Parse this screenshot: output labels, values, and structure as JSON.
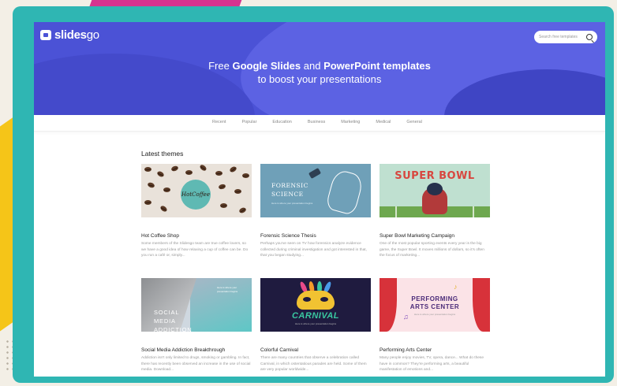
{
  "brand": {
    "logo_bold": "slides",
    "logo_light": "go"
  },
  "search": {
    "placeholder": "Search free templates"
  },
  "hero": {
    "line1_pre": "Free ",
    "line1_bold1": "Google Slides",
    "line1_mid": " and ",
    "line1_bold2": "PowerPoint templates",
    "line2": "to boost your presentations"
  },
  "categories": [
    "Recent",
    "Popular",
    "Education",
    "Business",
    "Marketing",
    "Medical",
    "General"
  ],
  "section_title": "Latest themes",
  "themes": [
    {
      "title": "Hot Coffee Shop",
      "description": "Some members of the Slidesgo team are true coffee lovers, so we have a good idea of how relaxing a cup of coffee can be. Do you run a café or, simply...",
      "thumb_text": "HotCoffee"
    },
    {
      "title": "Forensic Science Thesis",
      "description": "Perhaps you've seen on TV how forensics analyze evidence collected during criminal investigation and got interested in that, that you began studying...",
      "thumb_text": "FORENSIC SCIENCE",
      "thumb_sub": "Here is where your presentation begins"
    },
    {
      "title": "Super Bowl Marketing Campaign",
      "description": "One of the most popular sporting events every year is the big game, the Super Bowl. It moves millions of dollars, so it's often the focus of marketing...",
      "thumb_text": "SUPER BOWL"
    },
    {
      "title": "Social Media Addiction Breakthrough",
      "description": "Addiction isn't only limited to drugs, smoking or gambling. In fact, there has recently been observed an increase in the use of social media. Download...",
      "thumb_text": "SOCIAL MEDIA ADDICTION",
      "thumb_sub": "Here is where your presentation begins"
    },
    {
      "title": "Colorful Carnival",
      "description": "There are many countries that observe a celebration called Carnival, in which ostentatious parades are held. Some of them are very popular worldwide...",
      "thumb_text": "CARNIVAL",
      "thumb_sub": "Here is where your presentation begins"
    },
    {
      "title": "Performing Arts Center",
      "description": "Many people enjoy movies, TV, opera, dance... What do these have in common? They're performing arts, a beautiful manifestation of emotions and...",
      "thumb_text": "PERFORMING ARTS CENTER",
      "thumb_sub": "Here is where your presentation begins"
    }
  ],
  "colors": {
    "frame": "#2fb6b3",
    "hero": "#4b52d6",
    "accent_pink": "#d6338f",
    "accent_yellow": "#f5c518"
  }
}
